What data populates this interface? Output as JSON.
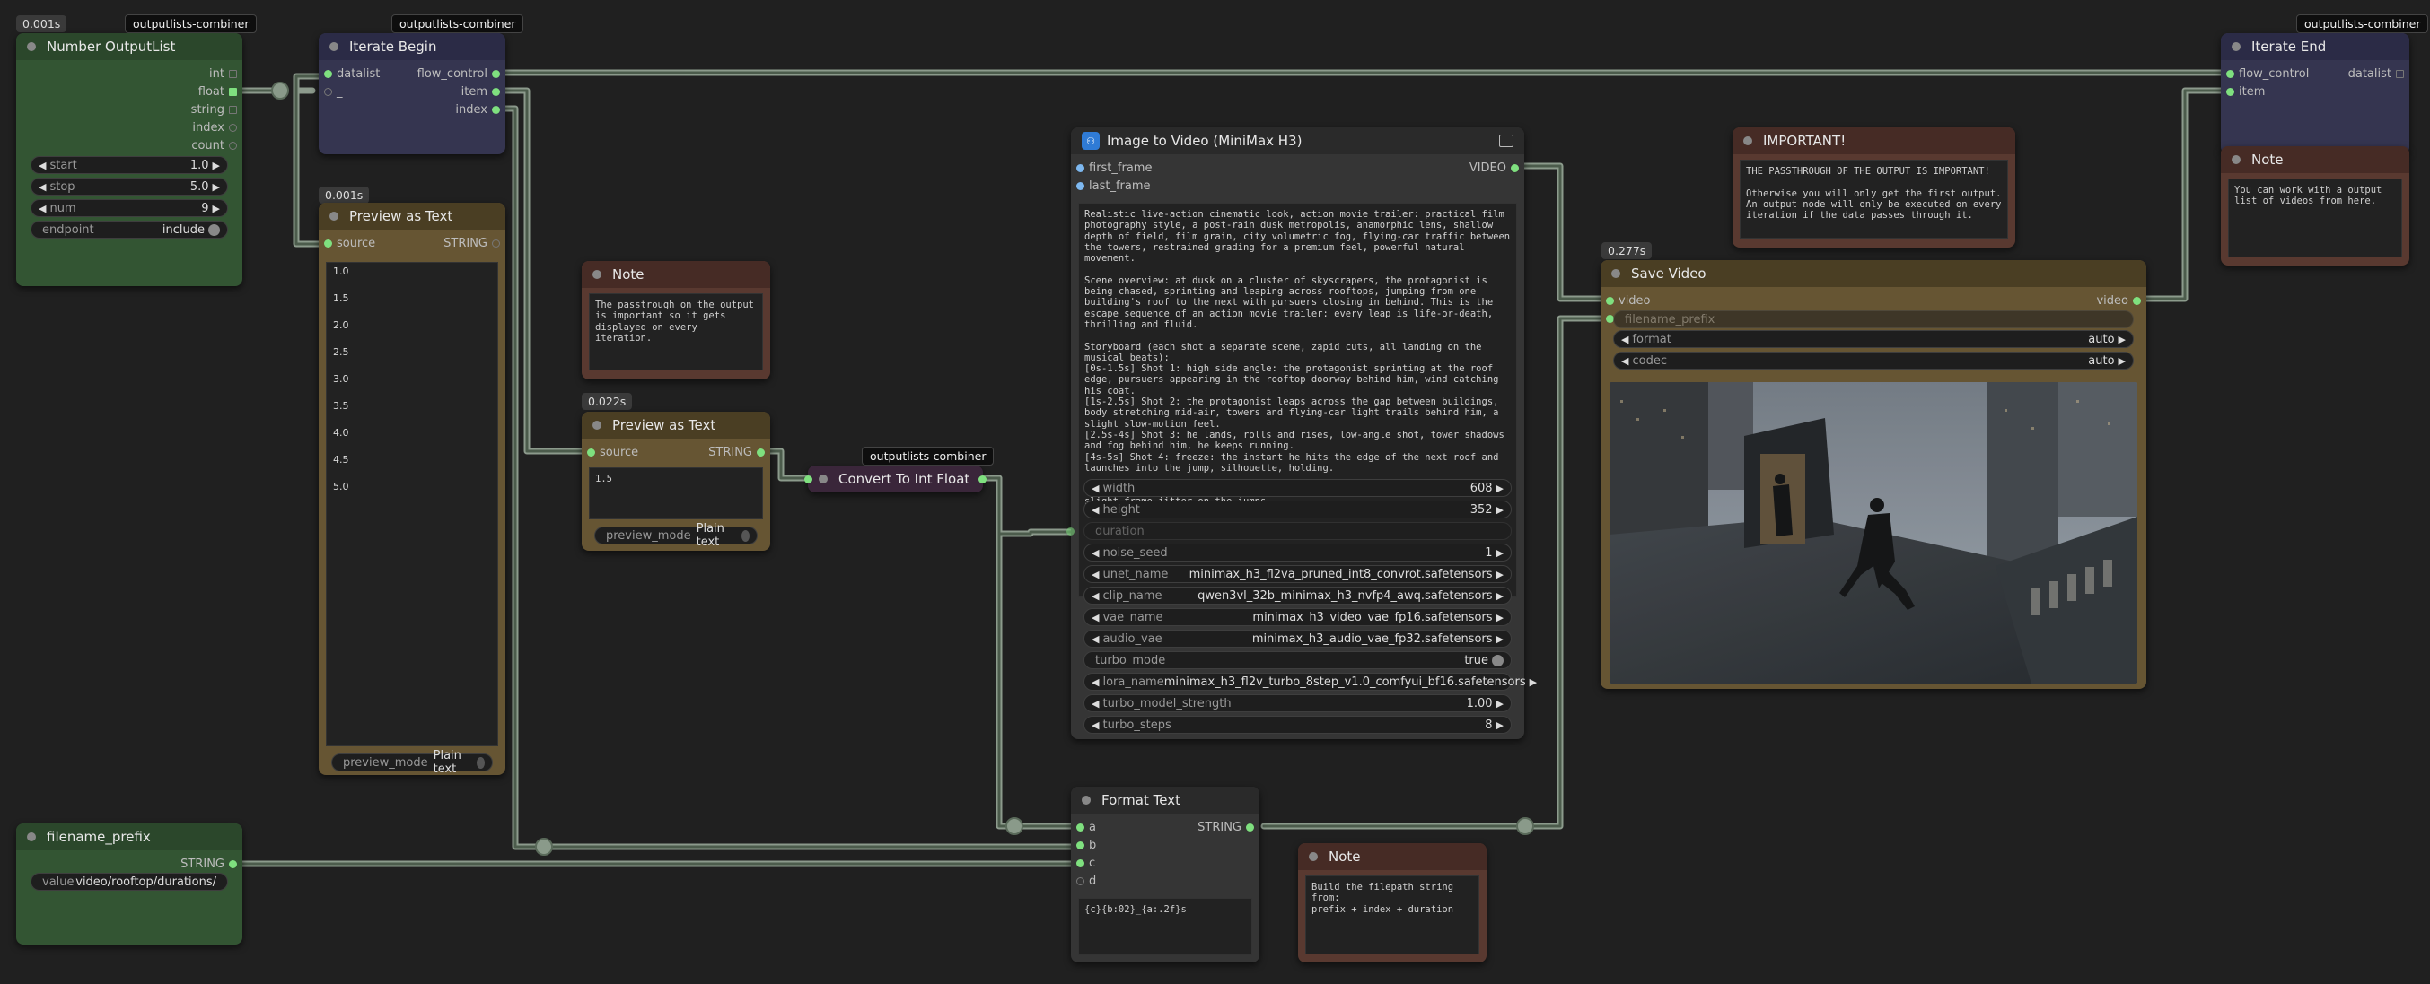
{
  "tags": {
    "combiner": "outputlists-combiner"
  },
  "times": {
    "t1": "0.001s",
    "t2": "0.001s",
    "t3": "0.022s",
    "t4": "0.277s"
  },
  "number_outputlist": {
    "title": "Number OutputList",
    "outputs": [
      "int",
      "float",
      "string",
      "index",
      "count"
    ],
    "start_label": "start",
    "start_value": "1.0",
    "stop_label": "stop",
    "stop_value": "5.0",
    "num_label": "num",
    "num_value": "9",
    "endpoint_label": "endpoint",
    "endpoint_value": "include"
  },
  "iterate_begin": {
    "title": "Iterate Begin",
    "in1": "datalist",
    "in2": "_",
    "out1": "flow_control",
    "out2": "item",
    "out3": "index"
  },
  "iterate_end": {
    "title": "Iterate End",
    "in1": "flow_control",
    "in2": "item",
    "out1": "datalist"
  },
  "preview1": {
    "title": "Preview as Text",
    "in": "source",
    "out": "STRING",
    "values": [
      "1.0",
      "1.5",
      "2.0",
      "2.5",
      "3.0",
      "3.5",
      "4.0",
      "4.5",
      "5.0"
    ],
    "mode_label": "preview_mode",
    "mode_value": "Plain text"
  },
  "preview2": {
    "title": "Preview as Text",
    "in": "source",
    "out": "STRING",
    "value": "1.5",
    "mode_label": "preview_mode",
    "mode_value": "Plain text"
  },
  "note1": {
    "title": "Note",
    "text": "The passtrough on the output is important so it gets displayed on every iteration."
  },
  "convert": {
    "title": "Convert To Int Float"
  },
  "i2v": {
    "title": "Image to Video (MiniMax H3)",
    "in1": "first_frame",
    "in2": "last_frame",
    "out": "VIDEO",
    "prompt": "Realistic live-action cinematic look, action movie trailer: practical film photography style, a post-rain dusk metropolis, anamorphic lens, shallow depth of field, film grain, city volumetric fog, flying-car traffic between the towers, restrained grading for a premium feel, powerful natural movement.\n\nScene overview: at dusk on a cluster of skyscrapers, the protagonist is being chased, sprinting and leaping across rooftops, jumping from one building's roof to the next with pursuers closing in behind. This is the escape sequence of an action movie trailer: every leap is life-or-death, thrilling and fluid.\n\nStoryboard (each shot a separate scene, zapid cuts, all landing on the musical beats):\n[0s-1.5s] Shot 1: high side angle: the protagonist sprinting at the roof edge, pursuers appearing in the rooftop doorway behind him, wind catching his coat.\n[1s-2.5s] Shot 2: the protagonist leaps across the gap between buildings, body stretching mid-air, towers and flying-car light trails behind him, a slight slow-motion feel.\n[2.5s-4s] Shot 3: he lands, rolls and rises, low-angle shot, tower shadows and fog behind him, he keeps running.\n[4s-5s] Shot 4: freeze: the instant he hits the edge of the next roof and launches into the jump, silhouette, holding.\n\nCamera: each shot its own angle, cuts clean and hard, no dissolves, a slight frame jitter on the jumps.",
    "widgets": [
      {
        "label": "width",
        "value": "608"
      },
      {
        "label": "height",
        "value": "352"
      },
      {
        "label": "duration",
        "value": ""
      },
      {
        "label": "noise_seed",
        "value": "1"
      },
      {
        "label": "unet_name",
        "value": "minimax_h3_fl2va_pruned_int8_convrot.safetensors"
      },
      {
        "label": "clip_name",
        "value": "qwen3vl_32b_minimax_h3_nvfp4_awq.safetensors"
      },
      {
        "label": "vae_name",
        "value": "minimax_h3_video_vae_fp16.safetensors"
      },
      {
        "label": "audio_vae",
        "value": "minimax_h3_audio_vae_fp32.safetensors"
      },
      {
        "label": "turbo_mode",
        "value": "true"
      },
      {
        "label": "lora_name",
        "value": "minimax_h3_fl2v_turbo_8step_v1.0_comfyui_bf16.safetensors"
      },
      {
        "label": "turbo_model_strength",
        "value": "1.00"
      },
      {
        "label": "turbo_steps",
        "value": "8"
      }
    ]
  },
  "important": {
    "title": "IMPORTANT!",
    "text": "THE PASSTHROUGH OF THE OUTPUT IS IMPORTANT!\n\nOtherwise you will only get the first output. An output node will only be executed on every iteration if the data passes through it."
  },
  "note2": {
    "title": "Note",
    "text": "You can work with a output list of videos from here."
  },
  "save_video": {
    "title": "Save Video",
    "in1": "video",
    "in2": "filename_prefix",
    "out": "video",
    "format_label": "format",
    "format_value": "auto",
    "codec_label": "codec",
    "codec_value": "auto"
  },
  "filename_prefix": {
    "title": "filename_prefix",
    "out": "STRING",
    "value_label": "value",
    "value": "video/rooftop/durations/"
  },
  "format_text": {
    "title": "Format Text",
    "inputs": [
      "a",
      "b",
      "c",
      "d"
    ],
    "out": "STRING",
    "template": "{c}{b:02}_{a:.2f}s"
  },
  "note3": {
    "title": "Note",
    "text": "Build the filepath string from:\nprefix + index + duration"
  }
}
